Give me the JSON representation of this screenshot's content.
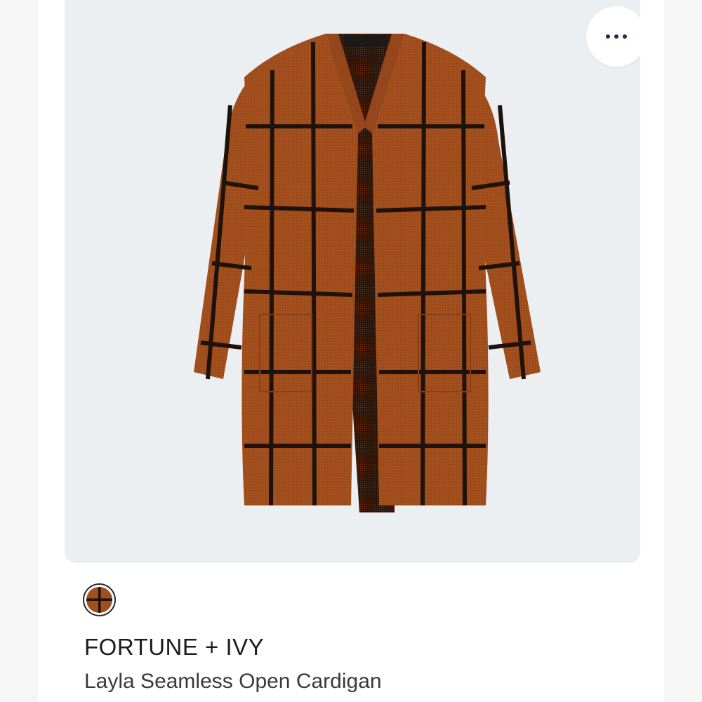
{
  "product": {
    "brand": "FORTUNE + IVY",
    "name": "Layla Seamless Open Cardigan",
    "image_label": "FORTUNE+IVY",
    "swatch_color": "#a24f1e",
    "pattern_color": "#1e120c"
  },
  "menu": {
    "icon": "more-horizontal-icon"
  }
}
